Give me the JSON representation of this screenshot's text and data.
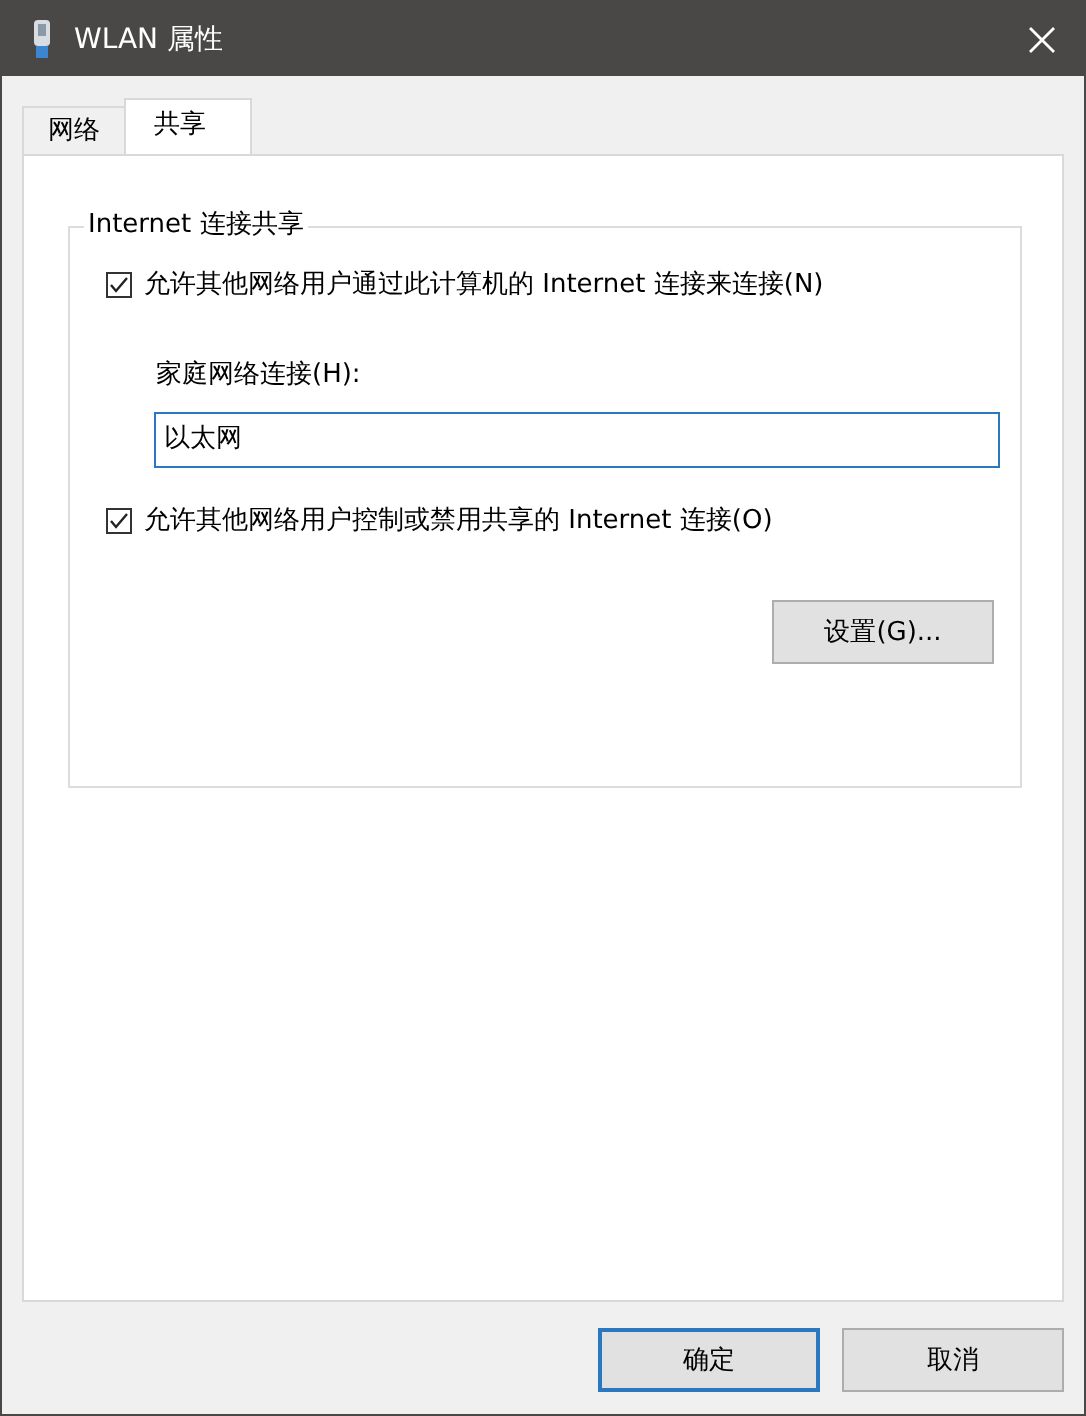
{
  "window": {
    "title": "WLAN 属性"
  },
  "tabs": [
    {
      "label": "网络",
      "selected": false
    },
    {
      "label": "共享",
      "selected": true
    }
  ],
  "group": {
    "title": "Internet 连接共享",
    "allow_sharing": {
      "label": "允许其他网络用户通过此计算机的 Internet 连接来连接(N)",
      "checked": true
    },
    "home_connection": {
      "label": "家庭网络连接(H):",
      "value": "以太网"
    },
    "allow_control": {
      "label": "允许其他网络用户控制或禁用共享的 Internet 连接(O)",
      "checked": true
    },
    "settings_button": "设置(G)..."
  },
  "buttons": [
    {
      "label": "确定",
      "selected": true
    },
    {
      "label": "取消",
      "selected": false
    }
  ]
}
